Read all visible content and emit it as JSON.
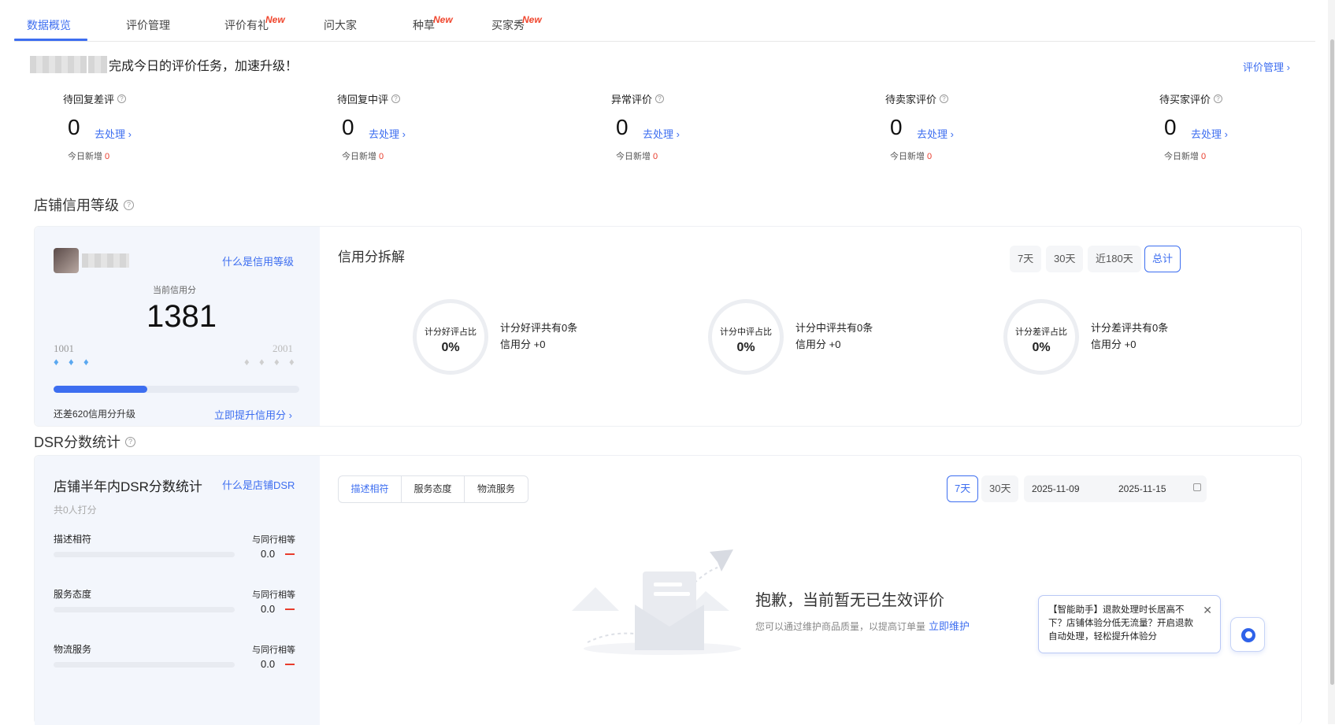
{
  "tabs": [
    {
      "label": "数据概览",
      "active": true
    },
    {
      "label": "评价管理"
    },
    {
      "label": "评价有礼",
      "badge": "New"
    },
    {
      "label": "问大家"
    },
    {
      "label": "种草",
      "badge": "New"
    },
    {
      "label": "买家秀",
      "badge": "New"
    }
  ],
  "greeting": "完成今日的评价任务，加速升级！",
  "top_link": "评价管理 ›",
  "stats": [
    {
      "label": "待回复差评",
      "value": "0",
      "action": "去处理 ›",
      "today_label": "今日新增",
      "today_value": "0"
    },
    {
      "label": "待回复中评",
      "value": "0",
      "action": "去处理 ›",
      "today_label": "今日新增",
      "today_value": "0"
    },
    {
      "label": "异常评价",
      "value": "0",
      "action": "去处理 ›",
      "today_label": "今日新增",
      "today_value": "0"
    },
    {
      "label": "待卖家评价",
      "value": "0",
      "action": "去处理 ›",
      "today_label": "今日新增",
      "today_value": "0"
    },
    {
      "label": "待买家评价",
      "value": "0",
      "action": "去处理 ›",
      "today_label": "今日新增",
      "today_value": "0"
    }
  ],
  "help_glyph": "?",
  "credit": {
    "section_title": "店铺信用等级",
    "what_link": "什么是信用等级",
    "current_label": "当前信用分",
    "current_value": "1381",
    "level_min": "1001",
    "level_max": "2001",
    "progress_fraction": 0.38,
    "remain_text": "还差620信用分升级",
    "improve_link": "立即提升信用分 ›",
    "breakdown_title": "信用分拆解",
    "ranges": [
      {
        "label": "7天"
      },
      {
        "label": "30天"
      },
      {
        "label": "近180天"
      },
      {
        "label": "总计",
        "active": true
      }
    ],
    "rings": [
      {
        "title": "计分好评占比",
        "pct": "0%",
        "line1": "计分好评共有0条",
        "line2": "信用分 +0"
      },
      {
        "title": "计分中评占比",
        "pct": "0%",
        "line1": "计分中评共有0条",
        "line2": "信用分 +0"
      },
      {
        "title": "计分差评占比",
        "pct": "0%",
        "line1": "计分差评共有0条",
        "line2": "信用分 +0"
      }
    ],
    "diamond_glyph": "♦"
  },
  "dsr": {
    "section_title": "DSR分数统计",
    "panel_title": "店铺半年内DSR分数统计",
    "what_link": "什么是店铺DSR",
    "count_text": "共0人打分",
    "metrics": [
      {
        "label": "描述相符",
        "compare": "与同行相等",
        "value": "0.0"
      },
      {
        "label": "服务态度",
        "compare": "与同行相等",
        "value": "0.0"
      },
      {
        "label": "物流服务",
        "compare": "与同行相等",
        "value": "0.0"
      }
    ],
    "segments": [
      {
        "label": "描述相符",
        "active": true
      },
      {
        "label": "服务态度"
      },
      {
        "label": "物流服务"
      }
    ],
    "ranges": [
      {
        "label": "7天",
        "active": true
      },
      {
        "label": "30天"
      }
    ],
    "date_start": "2025-11-09",
    "date_end": "2025-11-15",
    "empty_title": "抱歉，当前暂无已生效评价",
    "empty_sub": "您可以通过维护商品质量，以提高订单量",
    "empty_link": "立即维护"
  },
  "assistant": {
    "text": "【智能助手】退款处理时长居高不下？店铺体验分低无流量？开启退款自动处理，轻松提升体验分",
    "close": "✕"
  },
  "colors": {
    "accent": "#3d6ef0",
    "danger": "#e83c2c",
    "panel_bg": "#f3f6fc"
  }
}
